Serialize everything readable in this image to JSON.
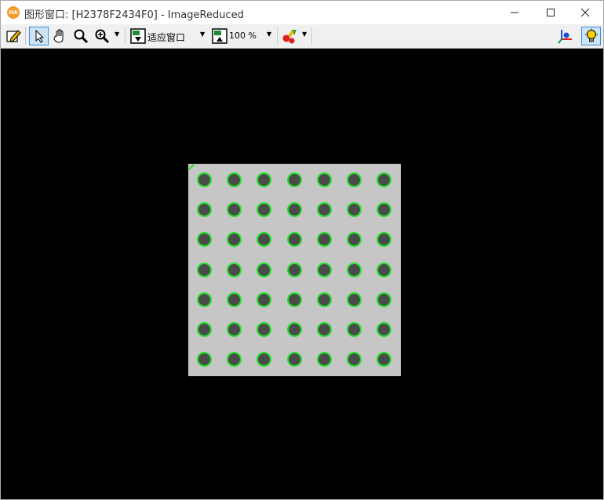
{
  "window": {
    "title": "图形窗口: [H2378F2434F0] - ImageReduced",
    "logo_text": "HA",
    "controls": [
      "minimize-icon",
      "maximize-icon",
      "close-icon"
    ]
  },
  "toolbar": {
    "zoom_mode_label": "适应窗口",
    "zoom_percent_label": "100  %",
    "icons": [
      "edit-icon",
      "pointer-icon",
      "hand-icon",
      "magnifier-icon",
      "zoom-in-icon",
      "fit-window-icon",
      "zoom-percent-icon",
      "color-icon",
      "axes-icon",
      "lightbulb-icon"
    ]
  },
  "canvas": {
    "background": "#000000",
    "board_color": "#c6c6c6",
    "marker_color": "#22e32a",
    "dot_color": "#4b4b4b",
    "grid_rows": 7,
    "grid_cols": 7
  }
}
